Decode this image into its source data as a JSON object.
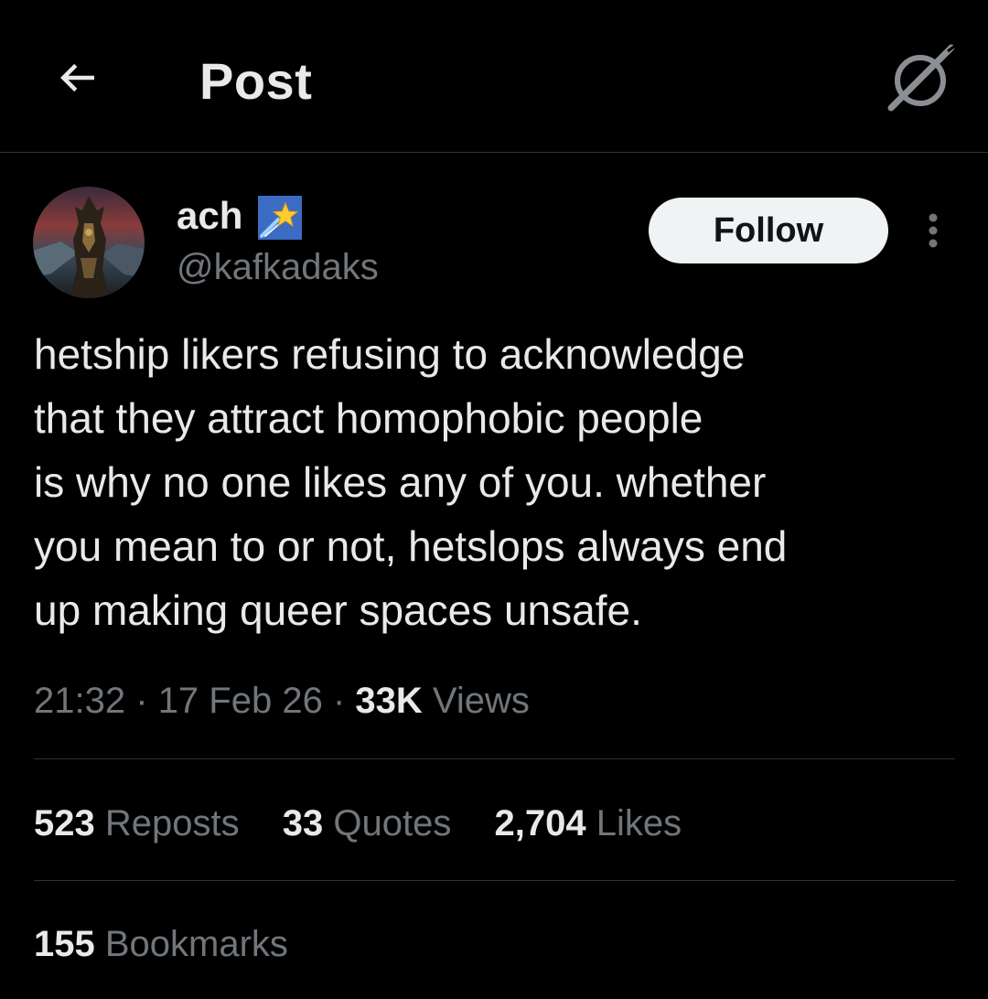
{
  "header": {
    "title": "Post",
    "back_icon": "arrow-left-icon",
    "grok_icon": "grok-icon"
  },
  "author": {
    "display_name": "ach",
    "name_emoji": "shooting-star-emoji",
    "handle": "@kafkadaks",
    "follow_label": "Follow"
  },
  "tweet": {
    "text": "hetship likers refusing to acknowledge\nthat they attract homophobic people\nis why no one likes any of you. whether\nyou mean to or not, hetslops always end\nup making queer spaces unsafe."
  },
  "meta": {
    "time": "21:32",
    "sep1": "·",
    "date": "17 Feb 26",
    "sep2": "·",
    "views_count": "33K",
    "views_label": "Views"
  },
  "stats": {
    "reposts_count": "523",
    "reposts_label": "Reposts",
    "quotes_count": "33",
    "quotes_label": "Quotes",
    "likes_count": "2,704",
    "likes_label": "Likes",
    "bookmarks_count": "155",
    "bookmarks_label": "Bookmarks"
  },
  "colors": {
    "background": "#000000",
    "primary_text": "#e7e9ea",
    "secondary_text": "#71767b",
    "divider": "#2f3336",
    "follow_bg": "#eff3f4"
  }
}
